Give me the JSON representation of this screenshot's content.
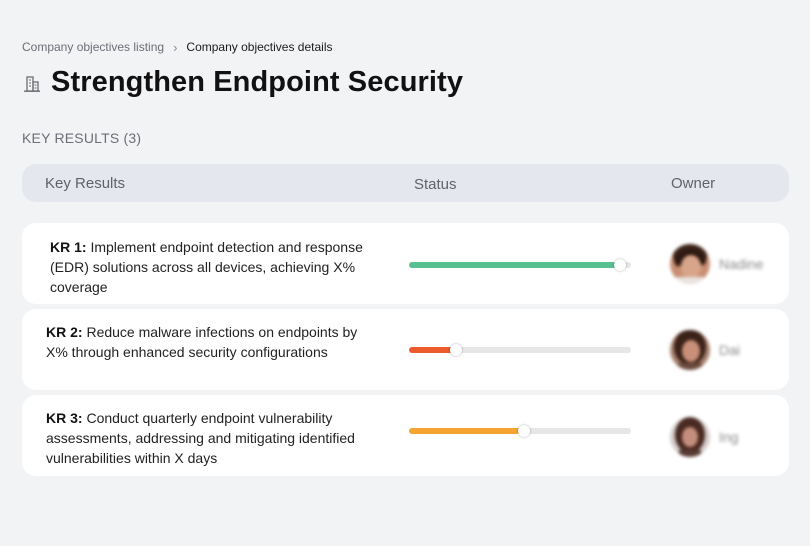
{
  "breadcrumb": {
    "parent": "Company objectives listing",
    "separator": "›",
    "current": "Company objectives details"
  },
  "page": {
    "title": "Strengthen Endpoint Security",
    "icon": "buildings-icon"
  },
  "section": {
    "label": "KEY RESULTS (3)"
  },
  "table": {
    "columns": [
      "Key Results",
      "Status",
      "Owner"
    ]
  },
  "key_results": [
    {
      "id": "KR 1:",
      "text": " Implement endpoint detection and response (EDR) solutions across all devices, achieving X% coverage",
      "progress": 0.95,
      "color": "#56c18e",
      "owner": "Nadine"
    },
    {
      "id": "KR 2:",
      "text": " Reduce malware infections on endpoints by X% through enhanced security configurations",
      "progress": 0.21,
      "color": "#ec5a2e",
      "owner": "Dai"
    },
    {
      "id": "KR 3:",
      "text": " Conduct quarterly endpoint vulnerability assessments, addressing and mitigating identified vulnerabilities within X days",
      "progress": 0.52,
      "color": "#f5a331",
      "owner": "Ing"
    }
  ]
}
